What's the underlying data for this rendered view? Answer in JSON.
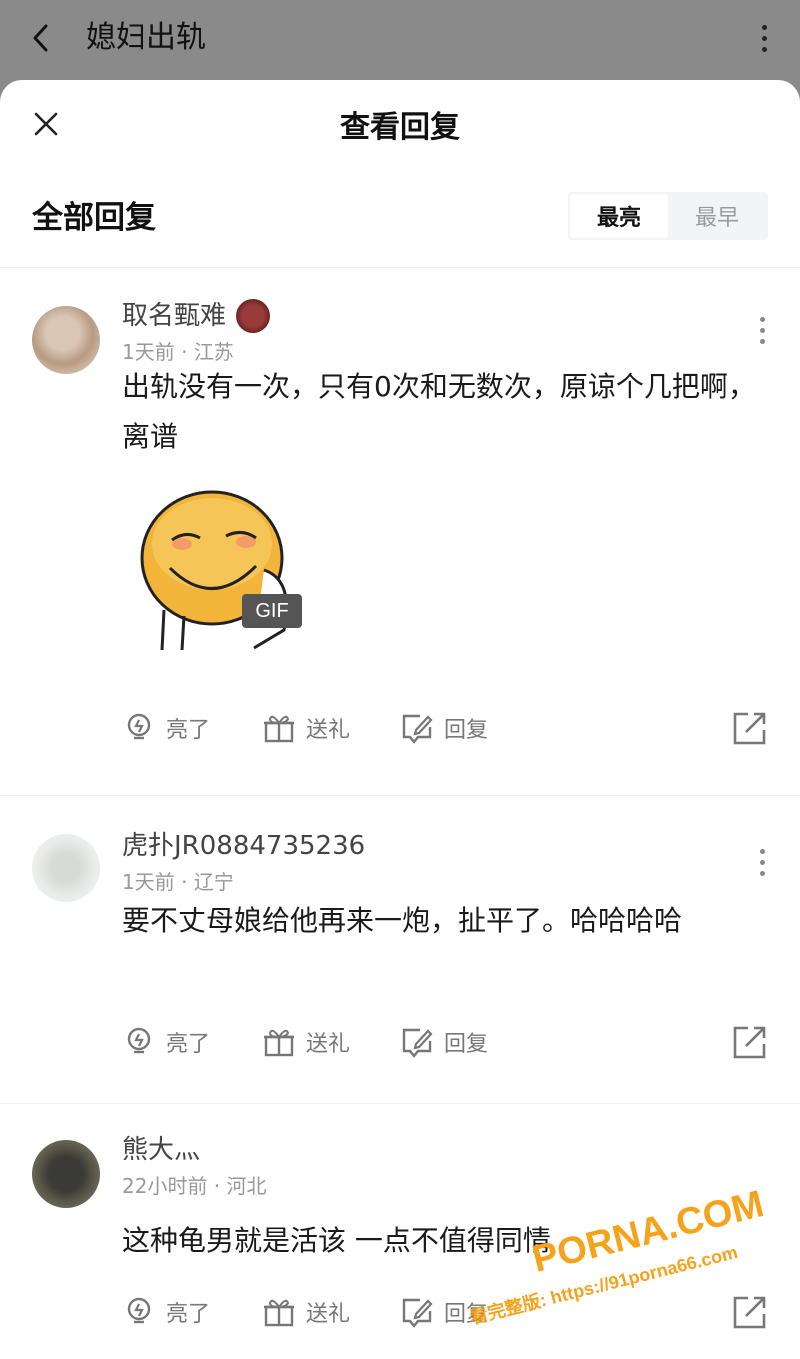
{
  "app_bar": {
    "title": "媳妇出轨"
  },
  "sheet": {
    "title": "查看回复",
    "section_title": "全部回复",
    "sort_options": [
      {
        "label": "最亮",
        "active": true
      },
      {
        "label": "最早",
        "active": false
      }
    ]
  },
  "actions_labels": {
    "like": "亮了",
    "gift": "送礼",
    "reply": "回复"
  },
  "comments": [
    {
      "username": "取名甄难",
      "time": "1天前",
      "location": "江苏",
      "text": "出轨没有一次，只有0次和无数次，原谅个几把啊，离谱",
      "has_gif": true,
      "gif_badge": "GIF"
    },
    {
      "username": "虎扑JR0884735236",
      "time": "1天前",
      "location": "辽宁",
      "text": "要不丈母娘给他再来一炮，扯平了。哈哈哈哈",
      "has_gif": false
    },
    {
      "username": "熊大灬",
      "time": "22小时前",
      "location": "河北",
      "text": "这种龟男就是活该 一点不值得同情",
      "has_gif": false
    }
  ],
  "watermark": {
    "brand": "PORNA.COM",
    "line": "看完整版: https://91porna66.com"
  },
  "colors": {
    "accent_orange": "#f7a21b",
    "meta_gray": "#999999",
    "icon_gray": "#777777"
  }
}
